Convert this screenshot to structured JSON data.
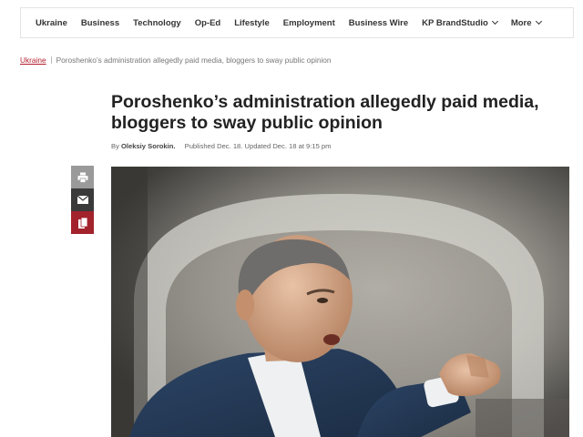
{
  "nav": {
    "items": [
      "Ukraine",
      "Business",
      "Technology",
      "Op-Ed",
      "Lifestyle",
      "Employment",
      "Business Wire"
    ],
    "dropdowns": [
      "KP BrandStudio",
      "More"
    ]
  },
  "breadcrumb": {
    "section": "Ukraine",
    "current": "Poroshenko’s administration allegedly paid media, bloggers to sway public opinion"
  },
  "article": {
    "title": "Poroshenko’s administration allegedly paid media, bloggers to sway public opinion",
    "by_prefix": "By",
    "author": "Oleksiy Sorokin.",
    "published": "Published Dec. 18. Updated Dec. 18 at 9:15 pm"
  },
  "share": {
    "icons": [
      "print-icon",
      "mail-icon",
      "bookmark-icon"
    ]
  },
  "colors": {
    "accent": "#b31e2f",
    "share_print": "#9a9a9a",
    "share_mail": "#3a3a3a",
    "share_bookmark": "#a3232d"
  }
}
